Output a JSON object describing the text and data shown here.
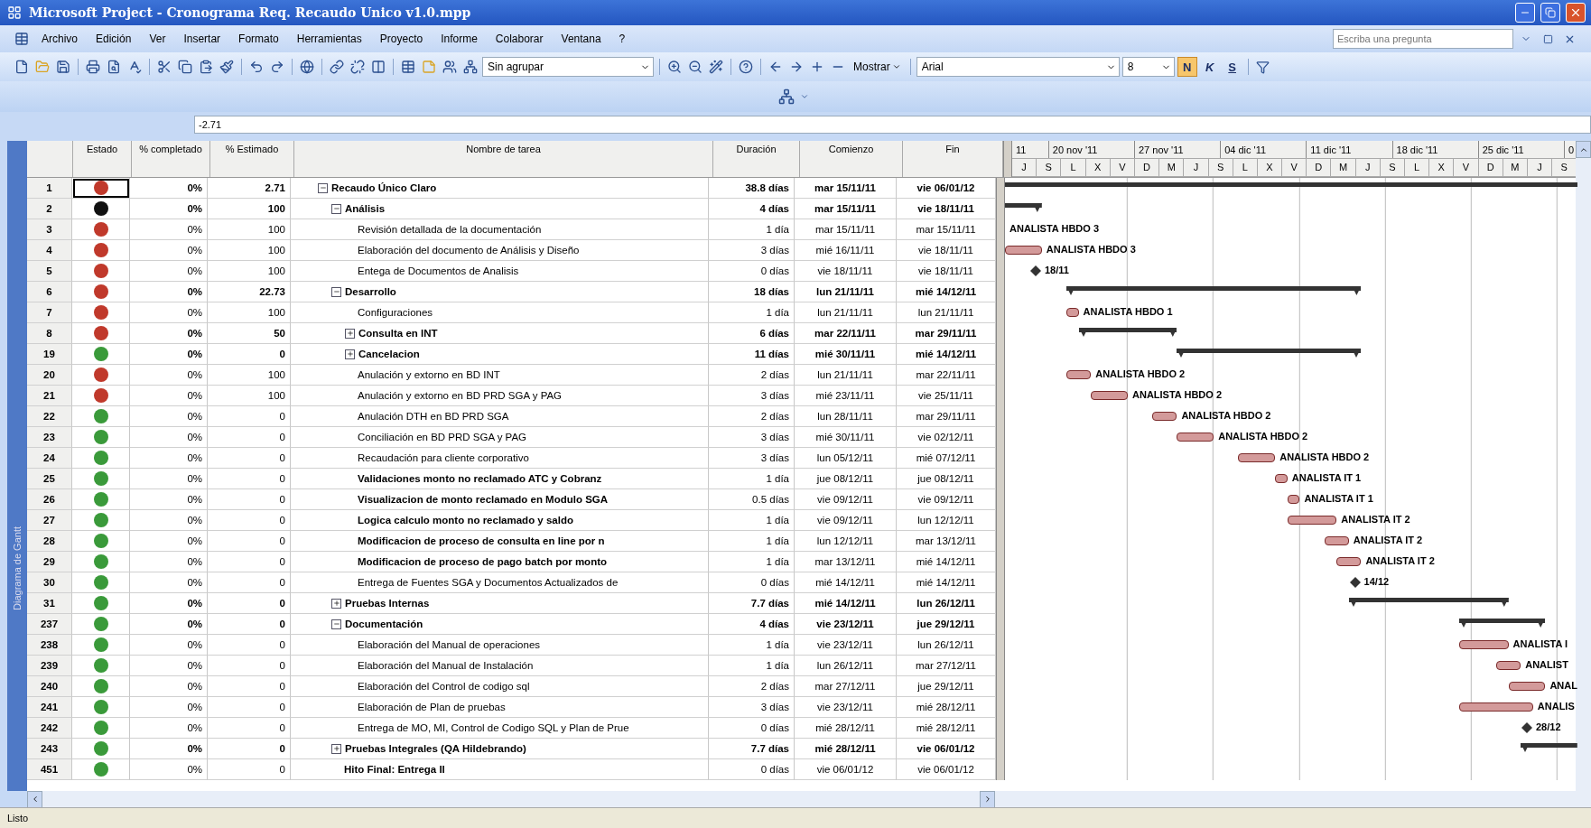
{
  "window": {
    "title": "Microsoft Project - Cronograma Req. Recaudo Unico v1.0.mpp"
  },
  "menu": [
    "Archivo",
    "Edición",
    "Ver",
    "Insertar",
    "Formato",
    "Herramientas",
    "Proyecto",
    "Informe",
    "Colaborar",
    "Ventana",
    "?"
  ],
  "help_search": {
    "placeholder": "Escriba una pregunta"
  },
  "toolbar": {
    "group_by": "Sin agrupar",
    "show_menu": "Mostrar",
    "font": "Arial",
    "font_size": "8",
    "format_buttons": [
      {
        "label": "N",
        "selected": true
      },
      {
        "label": "K",
        "selected": false
      },
      {
        "label": "S",
        "selected": false
      }
    ]
  },
  "entry_bar": {
    "value": "-2.71"
  },
  "view_bar": {
    "label": "Diagrama de Gantt"
  },
  "table": {
    "columns": [
      "Estado",
      "% completado",
      "% Estimado",
      "Nombre de tarea",
      "Duración",
      "Comienzo",
      "Fin"
    ],
    "tasks": [
      {
        "id": "1",
        "selected": true,
        "color": "#c0392b",
        "complete": "0%",
        "estimated": "2.71",
        "name": "Recaudo Único Claro",
        "kind": "summary",
        "bold": true,
        "expanded": true,
        "duration": "38.8 días",
        "start": "mar 15/11/11",
        "finish": "vie 06/01/12",
        "children": [
          {
            "id": "2",
            "selected": false,
            "color": "#111111",
            "complete": "0%",
            "estimated": "100",
            "name": "Análisis",
            "kind": "summary",
            "bold": true,
            "expanded": true,
            "duration": "4 días",
            "start": "mar 15/11/11",
            "finish": "vie 18/11/11",
            "children": [
              {
                "id": "3",
                "selected": false,
                "color": "#c0392b",
                "complete": "0%",
                "estimated": "100",
                "name": "Revisión detallada de la documentación",
                "kind": "task",
                "bold": false,
                "duration": "1 día",
                "start": "mar 15/11/11",
                "finish": "mar 15/11/11",
                "gantt_label": "ANALISTA HBDO 3"
              },
              {
                "id": "4",
                "selected": false,
                "color": "#c0392b",
                "complete": "0%",
                "estimated": "100",
                "name": "Elaboración del documento de Análisis y Diseño",
                "kind": "task",
                "bold": false,
                "duration": "3 días",
                "start": "mié 16/11/11",
                "finish": "vie 18/11/11",
                "gantt_label": "ANALISTA HBDO 3"
              },
              {
                "id": "5",
                "selected": false,
                "color": "#c0392b",
                "complete": "0%",
                "estimated": "100",
                "name": "Entega de Documentos de Analisis",
                "kind": "milestone",
                "bold": false,
                "duration": "0 días",
                "start": "vie 18/11/11",
                "finish": "vie 18/11/11",
                "gantt_label": "18/11"
              }
            ]
          },
          {
            "id": "6",
            "selected": false,
            "color": "#c0392b",
            "complete": "0%",
            "estimated": "22.73",
            "name": "Desarrollo",
            "kind": "summary",
            "bold": true,
            "expanded": true,
            "duration": "18 días",
            "start": "lun 21/11/11",
            "finish": "mié 14/12/11",
            "children": [
              {
                "id": "7",
                "selected": false,
                "color": "#c0392b",
                "complete": "0%",
                "estimated": "100",
                "name": "Configuraciones",
                "kind": "task",
                "bold": false,
                "duration": "1 día",
                "start": "lun 21/11/11",
                "finish": "lun 21/11/11",
                "gantt_label": "ANALISTA HBDO 1"
              },
              {
                "id": "8",
                "selected": false,
                "color": "#c0392b",
                "complete": "0%",
                "estimated": "50",
                "name": "Consulta en INT",
                "kind": "summary",
                "bold": true,
                "expanded": false,
                "duration": "6 días",
                "start": "mar 22/11/11",
                "finish": "mar 29/11/11"
              },
              {
                "id": "19",
                "selected": false,
                "color": "#3a9a3a",
                "complete": "0%",
                "estimated": "0",
                "name": "Cancelacion",
                "kind": "summary",
                "bold": true,
                "expanded": false,
                "duration": "11 días",
                "start": "mié 30/11/11",
                "finish": "mié 14/12/11"
              },
              {
                "id": "20",
                "selected": false,
                "color": "#c0392b",
                "complete": "0%",
                "estimated": "100",
                "name": "Anulación y extorno en BD INT",
                "kind": "task",
                "bold": false,
                "duration": "2 días",
                "start": "lun 21/11/11",
                "finish": "mar 22/11/11",
                "gantt_label": "ANALISTA HBDO 2"
              },
              {
                "id": "21",
                "selected": false,
                "color": "#c0392b",
                "complete": "0%",
                "estimated": "100",
                "name": "Anulación y extorno en BD PRD SGA y PAG",
                "kind": "task",
                "bold": false,
                "duration": "3 días",
                "start": "mié 23/11/11",
                "finish": "vie 25/11/11",
                "gantt_label": "ANALISTA HBDO 2"
              },
              {
                "id": "22",
                "selected": false,
                "color": "#3a9a3a",
                "complete": "0%",
                "estimated": "0",
                "name": "Anulación DTH en BD PRD SGA",
                "kind": "task",
                "bold": false,
                "duration": "2 días",
                "start": "lun 28/11/11",
                "finish": "mar 29/11/11",
                "gantt_label": "ANALISTA HBDO 2"
              },
              {
                "id": "23",
                "selected": false,
                "color": "#3a9a3a",
                "complete": "0%",
                "estimated": "0",
                "name": "Conciliación en BD PRD SGA y PAG",
                "kind": "task",
                "bold": false,
                "duration": "3 días",
                "start": "mié 30/11/11",
                "finish": "vie 02/12/11",
                "gantt_label": "ANALISTA HBDO 2"
              },
              {
                "id": "24",
                "selected": false,
                "color": "#3a9a3a",
                "complete": "0%",
                "estimated": "0",
                "name": "Recaudación para cliente corporativo",
                "kind": "task",
                "bold": false,
                "duration": "3 días",
                "start": "lun 05/12/11",
                "finish": "mié 07/12/11",
                "gantt_label": "ANALISTA HBDO 2"
              },
              {
                "id": "25",
                "selected": false,
                "color": "#3a9a3a",
                "complete": "0%",
                "estimated": "0",
                "name": "Validaciones monto no reclamado ATC y Cobranz",
                "kind": "task",
                "bold": true,
                "duration": "1 día",
                "start": "jue 08/12/11",
                "finish": "jue 08/12/11",
                "gantt_label": "ANALISTA IT 1"
              },
              {
                "id": "26",
                "selected": false,
                "color": "#3a9a3a",
                "complete": "0%",
                "estimated": "0",
                "name": "Visualizacion de monto reclamado en Modulo SGA",
                "kind": "task",
                "bold": true,
                "duration": "0.5 días",
                "start": "vie 09/12/11",
                "finish": "vie 09/12/11",
                "gantt_label": "ANALISTA IT 1"
              },
              {
                "id": "27",
                "selected": false,
                "color": "#3a9a3a",
                "complete": "0%",
                "estimated": "0",
                "name": "Logica calculo monto no reclamado y saldo",
                "kind": "task",
                "bold": true,
                "duration": "1 día",
                "start": "vie 09/12/11",
                "finish": "lun 12/12/11",
                "gantt_label": "ANALISTA IT 2"
              },
              {
                "id": "28",
                "selected": false,
                "color": "#3a9a3a",
                "complete": "0%",
                "estimated": "0",
                "name": "Modificacion de proceso de consulta en line por n",
                "kind": "task",
                "bold": true,
                "duration": "1 día",
                "start": "lun 12/12/11",
                "finish": "mar 13/12/11",
                "gantt_label": "ANALISTA IT 2"
              },
              {
                "id": "29",
                "selected": false,
                "color": "#3a9a3a",
                "complete": "0%",
                "estimated": "0",
                "name": "Modificacion de proceso de pago batch por monto",
                "kind": "task",
                "bold": true,
                "duration": "1 día",
                "start": "mar 13/12/11",
                "finish": "mié 14/12/11",
                "gantt_label": "ANALISTA IT 2"
              },
              {
                "id": "30",
                "selected": false,
                "color": "#3a9a3a",
                "complete": "0%",
                "estimated": "0",
                "name": "Entrega de Fuentes SGA y Documentos Actualizados de",
                "kind": "milestone",
                "bold": false,
                "duration": "0 días",
                "start": "mié 14/12/11",
                "finish": "mié 14/12/11",
                "gantt_label": "14/12"
              }
            ]
          },
          {
            "id": "31",
            "selected": false,
            "color": "#3a9a3a",
            "complete": "0%",
            "estimated": "0",
            "name": "Pruebas Internas",
            "kind": "summary",
            "bold": true,
            "expanded": false,
            "duration": "7.7 días",
            "start": "mié 14/12/11",
            "finish": "lun 26/12/11"
          },
          {
            "id": "237",
            "selected": false,
            "color": "#3a9a3a",
            "complete": "0%",
            "estimated": "0",
            "name": "Documentación",
            "kind": "summary",
            "bold": true,
            "expanded": true,
            "duration": "4 días",
            "start": "vie 23/12/11",
            "finish": "jue 29/12/11",
            "children": [
              {
                "id": "238",
                "selected": false,
                "color": "#3a9a3a",
                "complete": "0%",
                "estimated": "0",
                "name": "Elaboración del Manual de operaciones",
                "kind": "task",
                "bold": false,
                "duration": "1 día",
                "start": "vie 23/12/11",
                "finish": "lun 26/12/11",
                "gantt_label": "ANALISTA I"
              },
              {
                "id": "239",
                "selected": false,
                "color": "#3a9a3a",
                "complete": "0%",
                "estimated": "0",
                "name": "Elaboración del Manual de Instalación",
                "kind": "task",
                "bold": false,
                "duration": "1 día",
                "start": "lun 26/12/11",
                "finish": "mar 27/12/11",
                "gantt_label": "ANALIST"
              },
              {
                "id": "240",
                "selected": false,
                "color": "#3a9a3a",
                "complete": "0%",
                "estimated": "0",
                "name": "Elaboración del Control de codigo sql",
                "kind": "task",
                "bold": false,
                "duration": "2 días",
                "start": "mar 27/12/11",
                "finish": "jue 29/12/11",
                "gantt_label": "ANAL"
              },
              {
                "id": "241",
                "selected": false,
                "color": "#3a9a3a",
                "complete": "0%",
                "estimated": "0",
                "name": "Elaboración de Plan de pruebas",
                "kind": "task",
                "bold": false,
                "duration": "3 días",
                "start": "vie 23/12/11",
                "finish": "mié 28/12/11",
                "gantt_label": "ANALIS"
              },
              {
                "id": "242",
                "selected": false,
                "color": "#3a9a3a",
                "complete": "0%",
                "estimated": "0",
                "name": "Entrega de MO, MI, Control de Codigo SQL y Plan de Prue",
                "kind": "milestone",
                "bold": false,
                "duration": "0 días",
                "start": "mié 28/12/11",
                "finish": "mié 28/12/11",
                "gantt_label": "28/12"
              }
            ]
          },
          {
            "id": "243",
            "selected": false,
            "color": "#3a9a3a",
            "complete": "0%",
            "estimated": "0",
            "name": "Pruebas Integrales (QA Hildebrando)",
            "kind": "summary",
            "bold": true,
            "expanded": false,
            "duration": "7.7 días",
            "start": "mié 28/12/11",
            "finish": "vie 06/01/12"
          },
          {
            "id": "451",
            "selected": false,
            "color": "#3a9a3a",
            "complete": "0%",
            "estimated": "0",
            "name": "Hito Final: Entrega II",
            "kind": "milestone",
            "bold": true,
            "duration": "0 días",
            "start": "vie 06/01/12",
            "finish": "vie 06/01/12"
          }
        ]
      }
    ]
  },
  "timescale": {
    "major": [
      "11",
      "20 nov '11",
      "27 nov '11",
      "04 dic '11",
      "11 dic '11",
      "18 dic '11",
      "25 dic '11",
      "0"
    ],
    "minor": [
      "J",
      "S",
      "L",
      "X",
      "V",
      "D",
      "M",
      "J",
      "S",
      "L",
      "X",
      "V",
      "D",
      "M",
      "J",
      "S",
      "L",
      "X",
      "V",
      "D",
      "M",
      "J",
      "S"
    ]
  },
  "status_bar": {
    "text": "Listo"
  }
}
